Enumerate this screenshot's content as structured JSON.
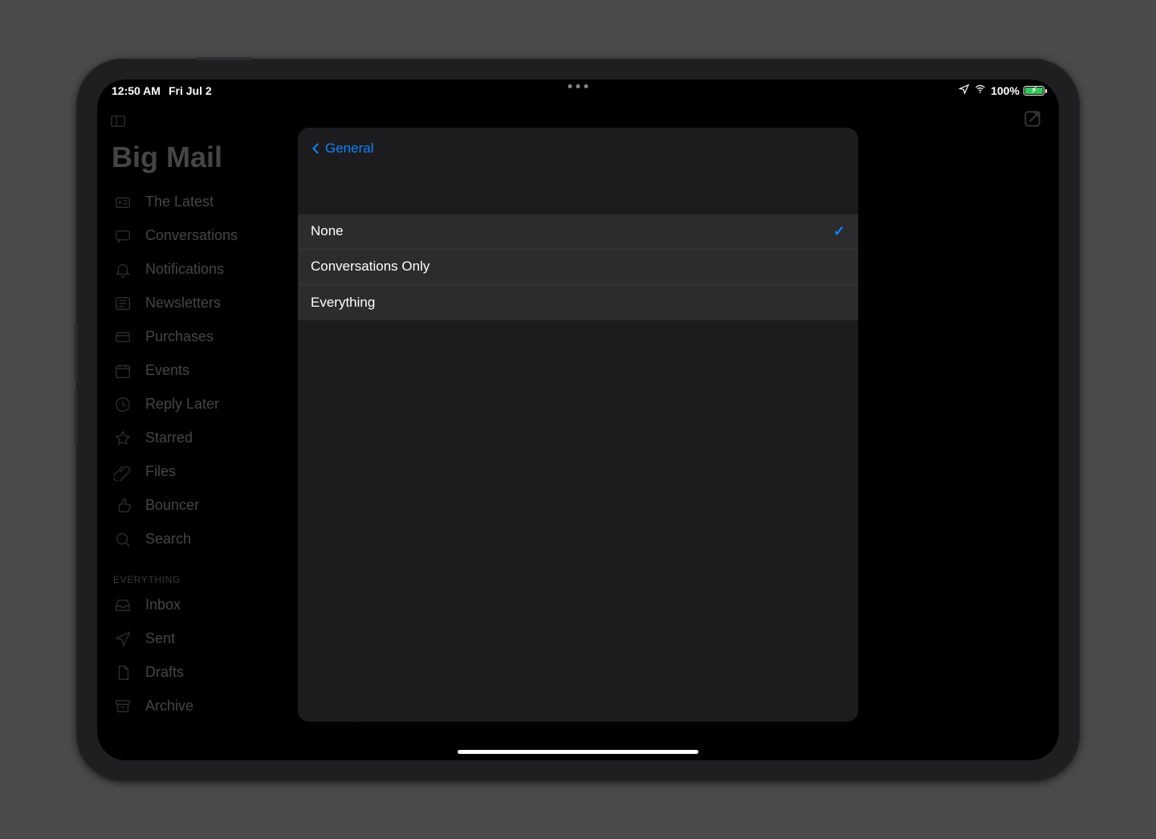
{
  "status": {
    "time": "12:50 AM",
    "date": "Fri Jul 2",
    "battery_pct": "100%"
  },
  "sidebar": {
    "title": "Big Mail",
    "items": [
      {
        "label": "The Latest",
        "icon": "radio-icon"
      },
      {
        "label": "Conversations",
        "icon": "chat-icon"
      },
      {
        "label": "Notifications",
        "icon": "bell-icon"
      },
      {
        "label": "Newsletters",
        "icon": "newspaper-icon"
      },
      {
        "label": "Purchases",
        "icon": "card-icon"
      },
      {
        "label": "Events",
        "icon": "calendar-icon"
      },
      {
        "label": "Reply Later",
        "icon": "clock-icon"
      },
      {
        "label": "Starred",
        "icon": "star-icon"
      },
      {
        "label": "Files",
        "icon": "paperclip-icon"
      },
      {
        "label": "Bouncer",
        "icon": "thumbsup-icon"
      },
      {
        "label": "Search",
        "icon": "search-icon"
      }
    ],
    "section_header": "EVERYTHING",
    "everything": [
      {
        "label": "Inbox",
        "icon": "inbox-icon"
      },
      {
        "label": "Sent",
        "icon": "send-icon"
      },
      {
        "label": "Drafts",
        "icon": "doc-icon"
      },
      {
        "label": "Archive",
        "icon": "archive-icon"
      }
    ]
  },
  "modal": {
    "back_label": "General",
    "options": [
      {
        "label": "None",
        "selected": true
      },
      {
        "label": "Conversations Only",
        "selected": false
      },
      {
        "label": "Everything",
        "selected": false
      }
    ]
  }
}
